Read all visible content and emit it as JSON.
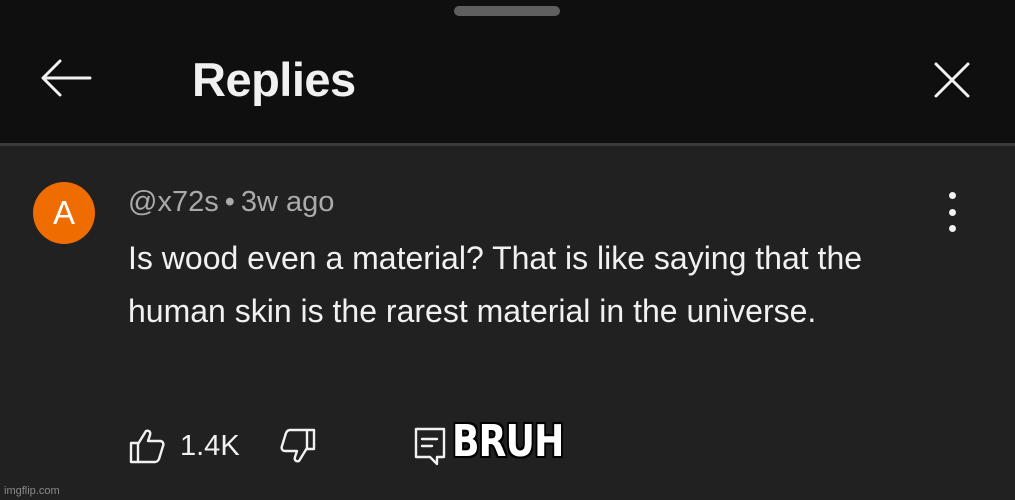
{
  "header": {
    "title": "Replies",
    "back_icon": "arrow-left-icon",
    "close_icon": "close-icon"
  },
  "comment": {
    "avatar_letter": "A",
    "avatar_color": "#ef6c00",
    "author": "@x72s",
    "separator": "•",
    "time": "3w ago",
    "text": "Is wood even a material? That is like saying that the human skin is the rarest material in the universe.",
    "menu_icon": "more-vertical-icon"
  },
  "actions": {
    "like_icon": "thumbs-up-icon",
    "like_count": "1.4K",
    "dislike_icon": "thumbs-down-icon",
    "reply_icon": "reply-comment-icon"
  },
  "overlay": {
    "caption": "BRUH"
  },
  "watermark": {
    "text": "imgflip.com"
  }
}
